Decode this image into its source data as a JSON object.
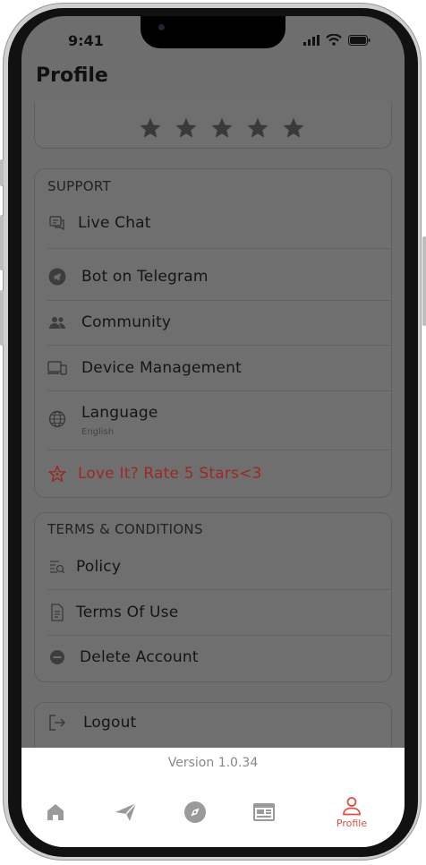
{
  "status": {
    "time": "9:41"
  },
  "header": {
    "title": "Profile"
  },
  "rating": {
    "stars": 5
  },
  "support": {
    "title": "SUPPORT",
    "items": [
      {
        "label": "Live Chat",
        "icon": "chat-icon"
      },
      {
        "label": "Bot on Telegram",
        "icon": "telegram-icon"
      },
      {
        "label": "Community",
        "icon": "community-icon"
      },
      {
        "label": "Device Management",
        "icon": "devices-icon"
      },
      {
        "label": "Language",
        "icon": "globe-icon",
        "value": "English"
      },
      {
        "label": "Love It? Rate 5 Stars<3",
        "icon": "star-outline-icon"
      }
    ]
  },
  "terms": {
    "title": "TERMS & CONDITIONS",
    "items": [
      {
        "label": "Policy",
        "icon": "policy-icon"
      },
      {
        "label": "Terms Of Use",
        "icon": "document-icon"
      },
      {
        "label": "Delete Account",
        "icon": "minus-circle-icon"
      }
    ]
  },
  "logout": {
    "label": "Logout",
    "icon": "logout-icon"
  },
  "footer": {
    "version": "Version 1.0.34"
  },
  "tabs": [
    {
      "icon": "home-icon",
      "label": ""
    },
    {
      "icon": "send-icon",
      "label": ""
    },
    {
      "icon": "compass-icon",
      "label": ""
    },
    {
      "icon": "calendar-icon",
      "label": ""
    },
    {
      "icon": "person-icon",
      "label": "Profile",
      "active": true
    }
  ],
  "colors": {
    "accent": "#e0503e",
    "overlay": "#6e6e6e"
  }
}
